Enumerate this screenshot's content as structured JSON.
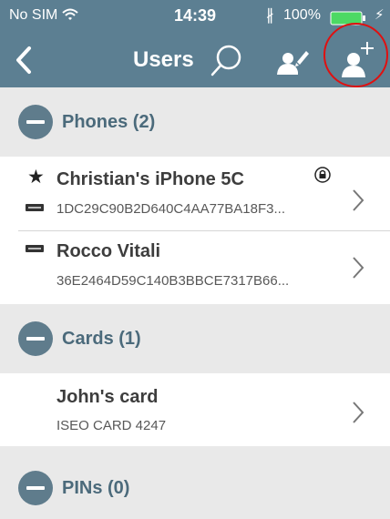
{
  "status_bar": {
    "carrier": "No SIM",
    "time": "14:39",
    "battery": "100%"
  },
  "nav": {
    "title": "Users",
    "back_icon": "chevron-left-icon",
    "search_icon": "search-icon",
    "edit_icon": "edit-user-icon",
    "add_icon": "add-user-icon"
  },
  "sections": [
    {
      "title": "Phones (2)",
      "rows": [
        {
          "title": "Christian's iPhone 5C",
          "subtitle": "1DC29C90B2D640C4AA77BA18F3...",
          "starred": true,
          "login": true,
          "locked": true
        },
        {
          "title": "Rocco Vitali",
          "subtitle": "36E2464D59C140B3BBCE7317B66...",
          "starred": false,
          "login": true,
          "locked": false
        }
      ]
    },
    {
      "title": "Cards (1)",
      "rows": [
        {
          "title": "John's card",
          "subtitle": "ISEO CARD 4247"
        }
      ]
    },
    {
      "title": "PINs (0)",
      "rows": []
    }
  ],
  "colors": {
    "header": "#5c7f92",
    "section_bg": "#e9e9e9",
    "section_text": "#4b6a7b",
    "highlight": "#e01010"
  }
}
